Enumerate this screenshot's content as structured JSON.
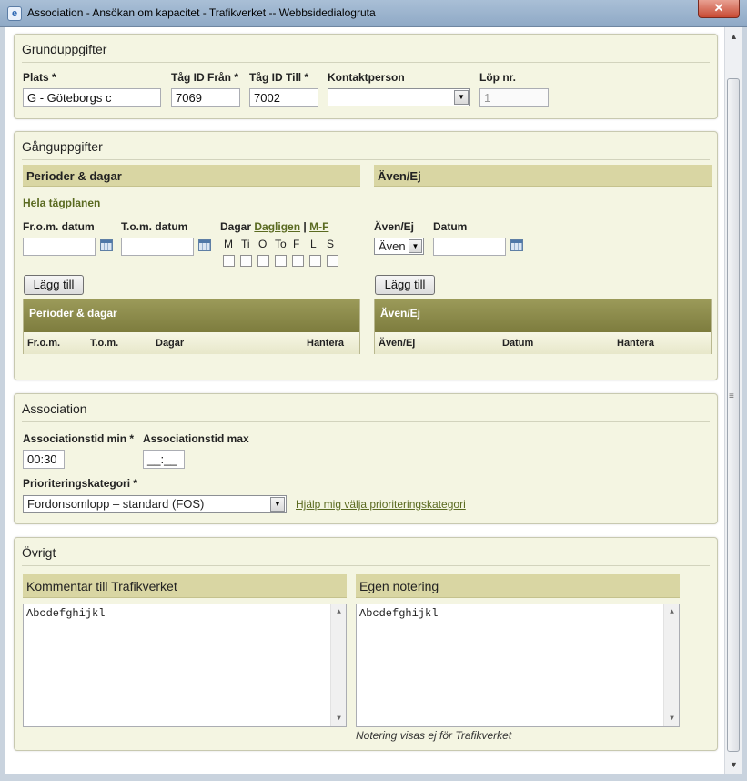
{
  "window": {
    "title": "Association - Ansökan om kapacitet - Trafikverket -- Webbsidedialogruta",
    "close_glyph": "✕"
  },
  "grunduppgifter": {
    "legend": "Grunduppgifter",
    "plats_label": "Plats *",
    "plats_value": "G - Göteborgs c",
    "tag_fran_label": "Tåg ID Från *",
    "tag_fran_value": "7069",
    "tag_till_label": "Tåg ID Till *",
    "tag_till_value": "7002",
    "kontakt_label": "Kontaktperson",
    "kontakt_value": "",
    "lop_label": "Löp nr.",
    "lop_value": "1"
  },
  "ganguppgifter": {
    "legend": "Gånguppgifter",
    "perioder_header": "Perioder & dagar",
    "aven_header": "Även/Ej",
    "hela_link": "Hela tågplanen",
    "from_label": "Fr.o.m. datum",
    "tom_label": "T.o.m. datum",
    "dagar_label": "Dagar",
    "dagligen_link": "Dagligen",
    "separator": "|",
    "mf_link": "M-F",
    "days": [
      "M",
      "Ti",
      "O",
      "To",
      "F",
      "L",
      "S"
    ],
    "aven_label": "Även/Ej",
    "datum_label": "Datum",
    "aven_select_value": "Även",
    "add_label": "Lägg till",
    "grid_left": {
      "title": "Perioder & dagar",
      "columns": [
        "Fr.o.m.",
        "T.o.m.",
        "Dagar",
        "Hantera"
      ]
    },
    "grid_right": {
      "title": "Även/Ej",
      "columns": [
        "Även/Ej",
        "Datum",
        "Hantera"
      ]
    }
  },
  "association": {
    "legend": "Association",
    "min_label": "Associationstid min *",
    "min_value": "00:30",
    "max_label": "Associationstid max",
    "max_value": "__:__",
    "prio_label": "Prioriteringskategori *",
    "prio_value": "Fordonsomlopp – standard (FOS)",
    "help_link": "Hjälp mig välja prioriteringskategori"
  },
  "ovrigt": {
    "legend": "Övrigt",
    "kommentar_header": "Kommentar till Trafikverket",
    "kommentar_value": "Abcdefghijkl",
    "egen_header": "Egen notering",
    "egen_value": "Abcdefghijkl",
    "note": "Notering visas ej för Trafikverket"
  },
  "icons": {
    "dropdown": "▼",
    "scroll_up": "▲",
    "scroll_down": "▼",
    "grip": "≡"
  }
}
